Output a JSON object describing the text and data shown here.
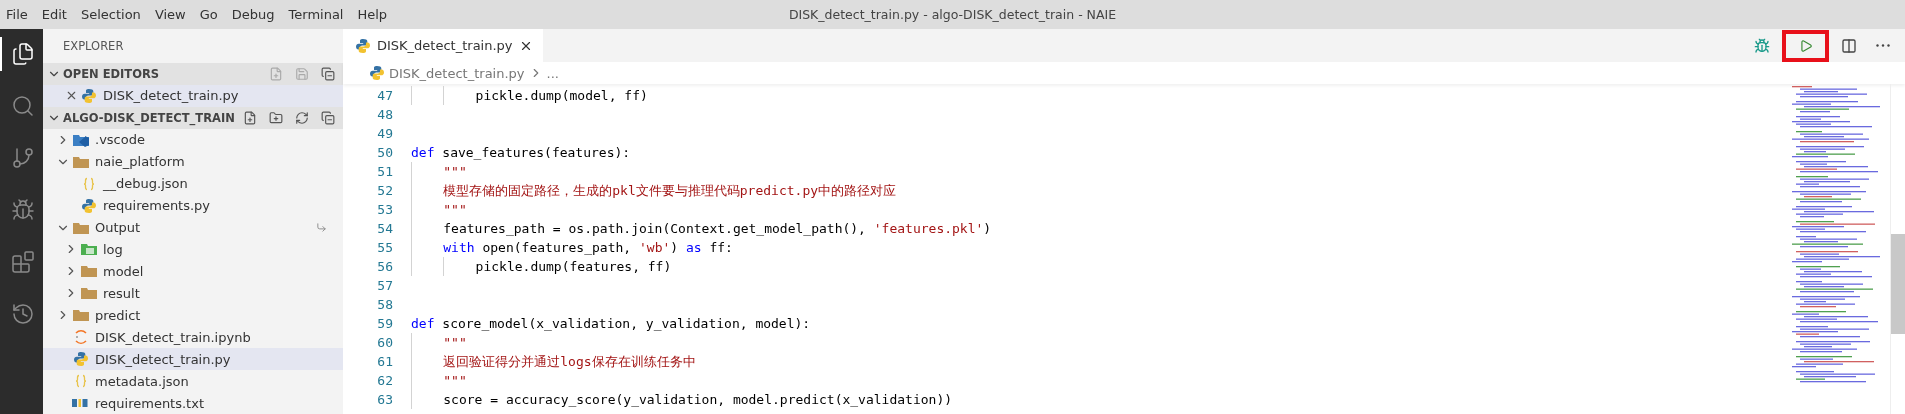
{
  "menu_bar": {
    "menus": [
      "File",
      "Edit",
      "Selection",
      "View",
      "Go",
      "Debug",
      "Terminal",
      "Help"
    ],
    "title": "DISK_detect_train.py - algo-DISK_detect_train - NAIE"
  },
  "activity_bar": [
    {
      "kind": "files",
      "selected": true
    },
    {
      "kind": "search",
      "selected": false
    },
    {
      "kind": "source-control",
      "selected": false
    },
    {
      "kind": "debug",
      "selected": false
    },
    {
      "kind": "extensions",
      "selected": false
    },
    {
      "kind": "history",
      "selected": false
    }
  ],
  "sidebar": {
    "title": "EXPLORER",
    "open_editors": {
      "label": "OPEN EDITORS",
      "expanded": true,
      "items": [
        {
          "label": "DISK_detect_train.py",
          "kind": "python",
          "selected": true
        }
      ]
    },
    "project": {
      "label": "ALGO-DISK_DETECT_TRAIN",
      "expanded": true,
      "items": [
        {
          "label": ".vscode",
          "kind": "vscode-folder",
          "expanded": false,
          "selected": false
        },
        {
          "label": "naie_platform",
          "kind": "folder",
          "expanded": true,
          "selected": false,
          "children": [
            {
              "label": "__debug.json",
              "kind": "json",
              "selected": false
            },
            {
              "label": "requirements.py",
              "kind": "python",
              "selected": false
            }
          ]
        },
        {
          "label": "Output",
          "kind": "folder",
          "expanded": true,
          "selected": false,
          "children": [
            {
              "label": "log",
              "kind": "log-folder",
              "expanded": false,
              "selected": false
            },
            {
              "label": "model",
              "kind": "folder",
              "expanded": false,
              "selected": false
            },
            {
              "label": "result",
              "kind": "folder",
              "expanded": false,
              "selected": false
            }
          ]
        },
        {
          "label": "predict",
          "kind": "folder",
          "expanded": false,
          "selected": false
        },
        {
          "label": "DISK_detect_train.ipynb",
          "kind": "notebook",
          "selected": false
        },
        {
          "label": "DISK_detect_train.py",
          "kind": "python",
          "selected": true
        },
        {
          "label": "metadata.json",
          "kind": "json",
          "selected": false
        },
        {
          "label": "requirements.txt",
          "kind": "text",
          "selected": false
        }
      ]
    }
  },
  "editor": {
    "tabs": [
      {
        "label": "DISK_detect_train.py",
        "selected": true
      }
    ],
    "actions": [
      {
        "kind": "debug",
        "highlighted": false
      },
      {
        "kind": "run",
        "highlighted": true
      },
      {
        "kind": "split",
        "highlighted": false
      },
      {
        "kind": "more",
        "highlighted": false
      }
    ],
    "breadcrumb": [
      "DISK_detect_train.py",
      "..."
    ],
    "lines": [
      {
        "number": "47",
        "tokens": [
          {
            "kind": "plain",
            "text": "        pickle.dump(model, ff)"
          }
        ]
      },
      {
        "number": "48"
      },
      {
        "number": "49"
      },
      {
        "number": "50",
        "tokens": [
          {
            "kind": "keyword",
            "text": "def"
          },
          {
            "kind": "plain",
            "text": " save_features(features):"
          }
        ]
      },
      {
        "number": "51",
        "tokens": [
          {
            "kind": "string",
            "text": "    \"\"\""
          }
        ]
      },
      {
        "number": "52",
        "tokens": [
          {
            "kind": "string",
            "text": "    模型存储的固定路径，生成的pkl文件要与推理代码predict.py中的路径对应"
          }
        ]
      },
      {
        "number": "53",
        "tokens": [
          {
            "kind": "string",
            "text": "    \"\"\""
          }
        ]
      },
      {
        "number": "54",
        "tokens": [
          {
            "kind": "plain",
            "text": "    features_path = os.path.join(Context.get_model_path(), "
          },
          {
            "kind": "string",
            "text": "'features.pkl'"
          },
          {
            "kind": "plain",
            "text": ")"
          }
        ]
      },
      {
        "number": "55",
        "tokens": [
          {
            "kind": "keyword",
            "text": "    with"
          },
          {
            "kind": "plain",
            "text": " open(features_path, "
          },
          {
            "kind": "string",
            "text": "'wb'"
          },
          {
            "kind": "plain",
            "text": ") "
          },
          {
            "kind": "keyword",
            "text": "as"
          },
          {
            "kind": "plain",
            "text": " ff:"
          }
        ]
      },
      {
        "number": "56",
        "tokens": [
          {
            "kind": "plain",
            "text": "        pickle.dump(features, ff)"
          }
        ]
      },
      {
        "number": "57"
      },
      {
        "number": "58"
      },
      {
        "number": "59",
        "tokens": [
          {
            "kind": "keyword",
            "text": "def"
          },
          {
            "kind": "plain",
            "text": " score_model(x_validation, y_validation, model):"
          }
        ]
      },
      {
        "number": "60",
        "tokens": [
          {
            "kind": "string",
            "text": "    \"\"\""
          }
        ]
      },
      {
        "number": "61",
        "tokens": [
          {
            "kind": "string",
            "text": "    返回验证得分并通过logs保存在训练任务中"
          }
        ]
      },
      {
        "number": "62",
        "tokens": [
          {
            "kind": "string",
            "text": "    \"\"\""
          }
        ]
      },
      {
        "number": "63",
        "tokens": [
          {
            "kind": "plain",
            "text": "    score = accuracy_score(y_validation, model.predict(x_validation))"
          }
        ]
      }
    ]
  }
}
